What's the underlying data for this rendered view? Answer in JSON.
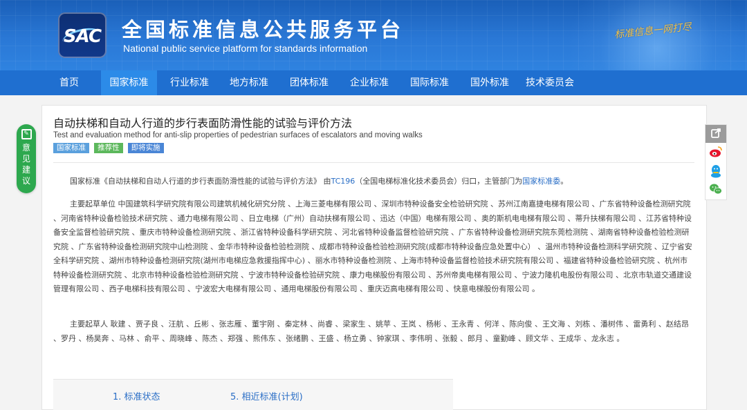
{
  "header": {
    "logo_text": "SAC",
    "title_cn": "全国标准信息公共服务平台",
    "title_en": "National public service platform  for standards information",
    "slogan": "标准信息一网打尽"
  },
  "nav": {
    "items": [
      {
        "label": "首页"
      },
      {
        "label": "国家标准"
      },
      {
        "label": "行业标准"
      },
      {
        "label": "地方标准"
      },
      {
        "label": "团体标准"
      },
      {
        "label": "企业标准"
      },
      {
        "label": "国际标准"
      },
      {
        "label": "国外标准"
      },
      {
        "label": "技术委员会"
      }
    ],
    "active_index": 1,
    "colors": {
      "bar": "#1f6fd0",
      "active": "#2c8be8"
    }
  },
  "standard": {
    "title": "自动扶梯和自动人行道的步行表面防滑性能的试验与评价方法",
    "title_en": "Test and evaluation method for anti-slip properties of pedestrian surfaces of escalators and moving walks",
    "badges": [
      {
        "label": "国家标准",
        "color": "#5aa0dd"
      },
      {
        "label": "推荐性",
        "color": "#5cb85c"
      },
      {
        "label": "即将实施",
        "color": "#4a86d6"
      }
    ]
  },
  "intro": {
    "prefix": "国家标准《自动扶梯和自动人行道的步行表面防滑性能的试验与评价方法》 由",
    "tc_link": "TC196",
    "middle": "（全国电梯标准化技术委员会）归口，主管部门为",
    "dept_link": "国家标准委",
    "suffix": "。"
  },
  "drafting_units": {
    "text": "主要起草单位 中国建筑科学研究院有限公司建筑机械化研究分院 、上海三菱电梯有限公司 、深圳市特种设备安全检验研究院 、苏州江南嘉捷电梯有限公司 、广东省特种设备检测研究院 、河南省特种设备检验技术研究院 、通力电梯有限公司 、日立电梯（广州）自动扶梯有限公司 、迅达（中国）电梯有限公司 、奥的斯机电电梯有限公司 、蒂升扶梯有限公司 、江苏省特种设备安全监督检验研究院 、重庆市特种设备检测研究院 、浙江省特种设备科学研究院 、河北省特种设备监督检验研究院 、广东省特种设备检测研究院东莞检测院 、湖南省特种设备检验检测研究院 、广东省特种设备检测研究院中山检测院 、金华市特种设备检验检测院 、成都市特种设备检验检测研究院(成都市特种设备应急处置中心） 、温州市特种设备检测科学研究院 、辽宁省安全科学研究院 、湖州市特种设备检测研究院(湖州市电梯应急救援指挥中心) 、丽水市特种设备检测院 、上海市特种设备监督检验技术研究院有限公司 、福建省特种设备检验研究院 、杭州市特种设备检测研究院 、北京市特种设备检验检测研究院 、宁波市特种设备检验研究院 、康力电梯股份有限公司 、苏州帝奥电梯有限公司 、宁波力隆机电股份有限公司 、北京市轨道交通建设管理有限公司 、西子电梯科技有限公司 、宁波宏大电梯有限公司 、通用电梯股份有限公司 、重庆迈高电梯有限公司 、快意电梯股份有限公司 。"
  },
  "drafters": {
    "text": "主要起草人 耿建 、贾子良 、汪航 、丘彬 、张志雁 、董宇刚 、秦定林 、尚睿 、梁家生 、姚苹 、王岚 、杨彬 、王永青 、何洋 、陈向俊 、王文海 、刘栋 、潘树伟 、雷勇利 、赵结昂 、罗丹 、杨昊奔 、马林 、俞平 、周晓峰 、陈杰 、郑强 、熊伟东 、张绪鹏 、王盛 、杨立勇 、钟家琪 、李伟明 、张毅 、郎月 、童勤峰 、顾文华 、王成华 、龙永志 。"
  },
  "tabs": [
    {
      "label": "1. 标准状态"
    },
    {
      "label": "5. 相近标准(计划)"
    }
  ],
  "feedback": {
    "chars": [
      "意",
      "见",
      "建",
      "议"
    ]
  }
}
